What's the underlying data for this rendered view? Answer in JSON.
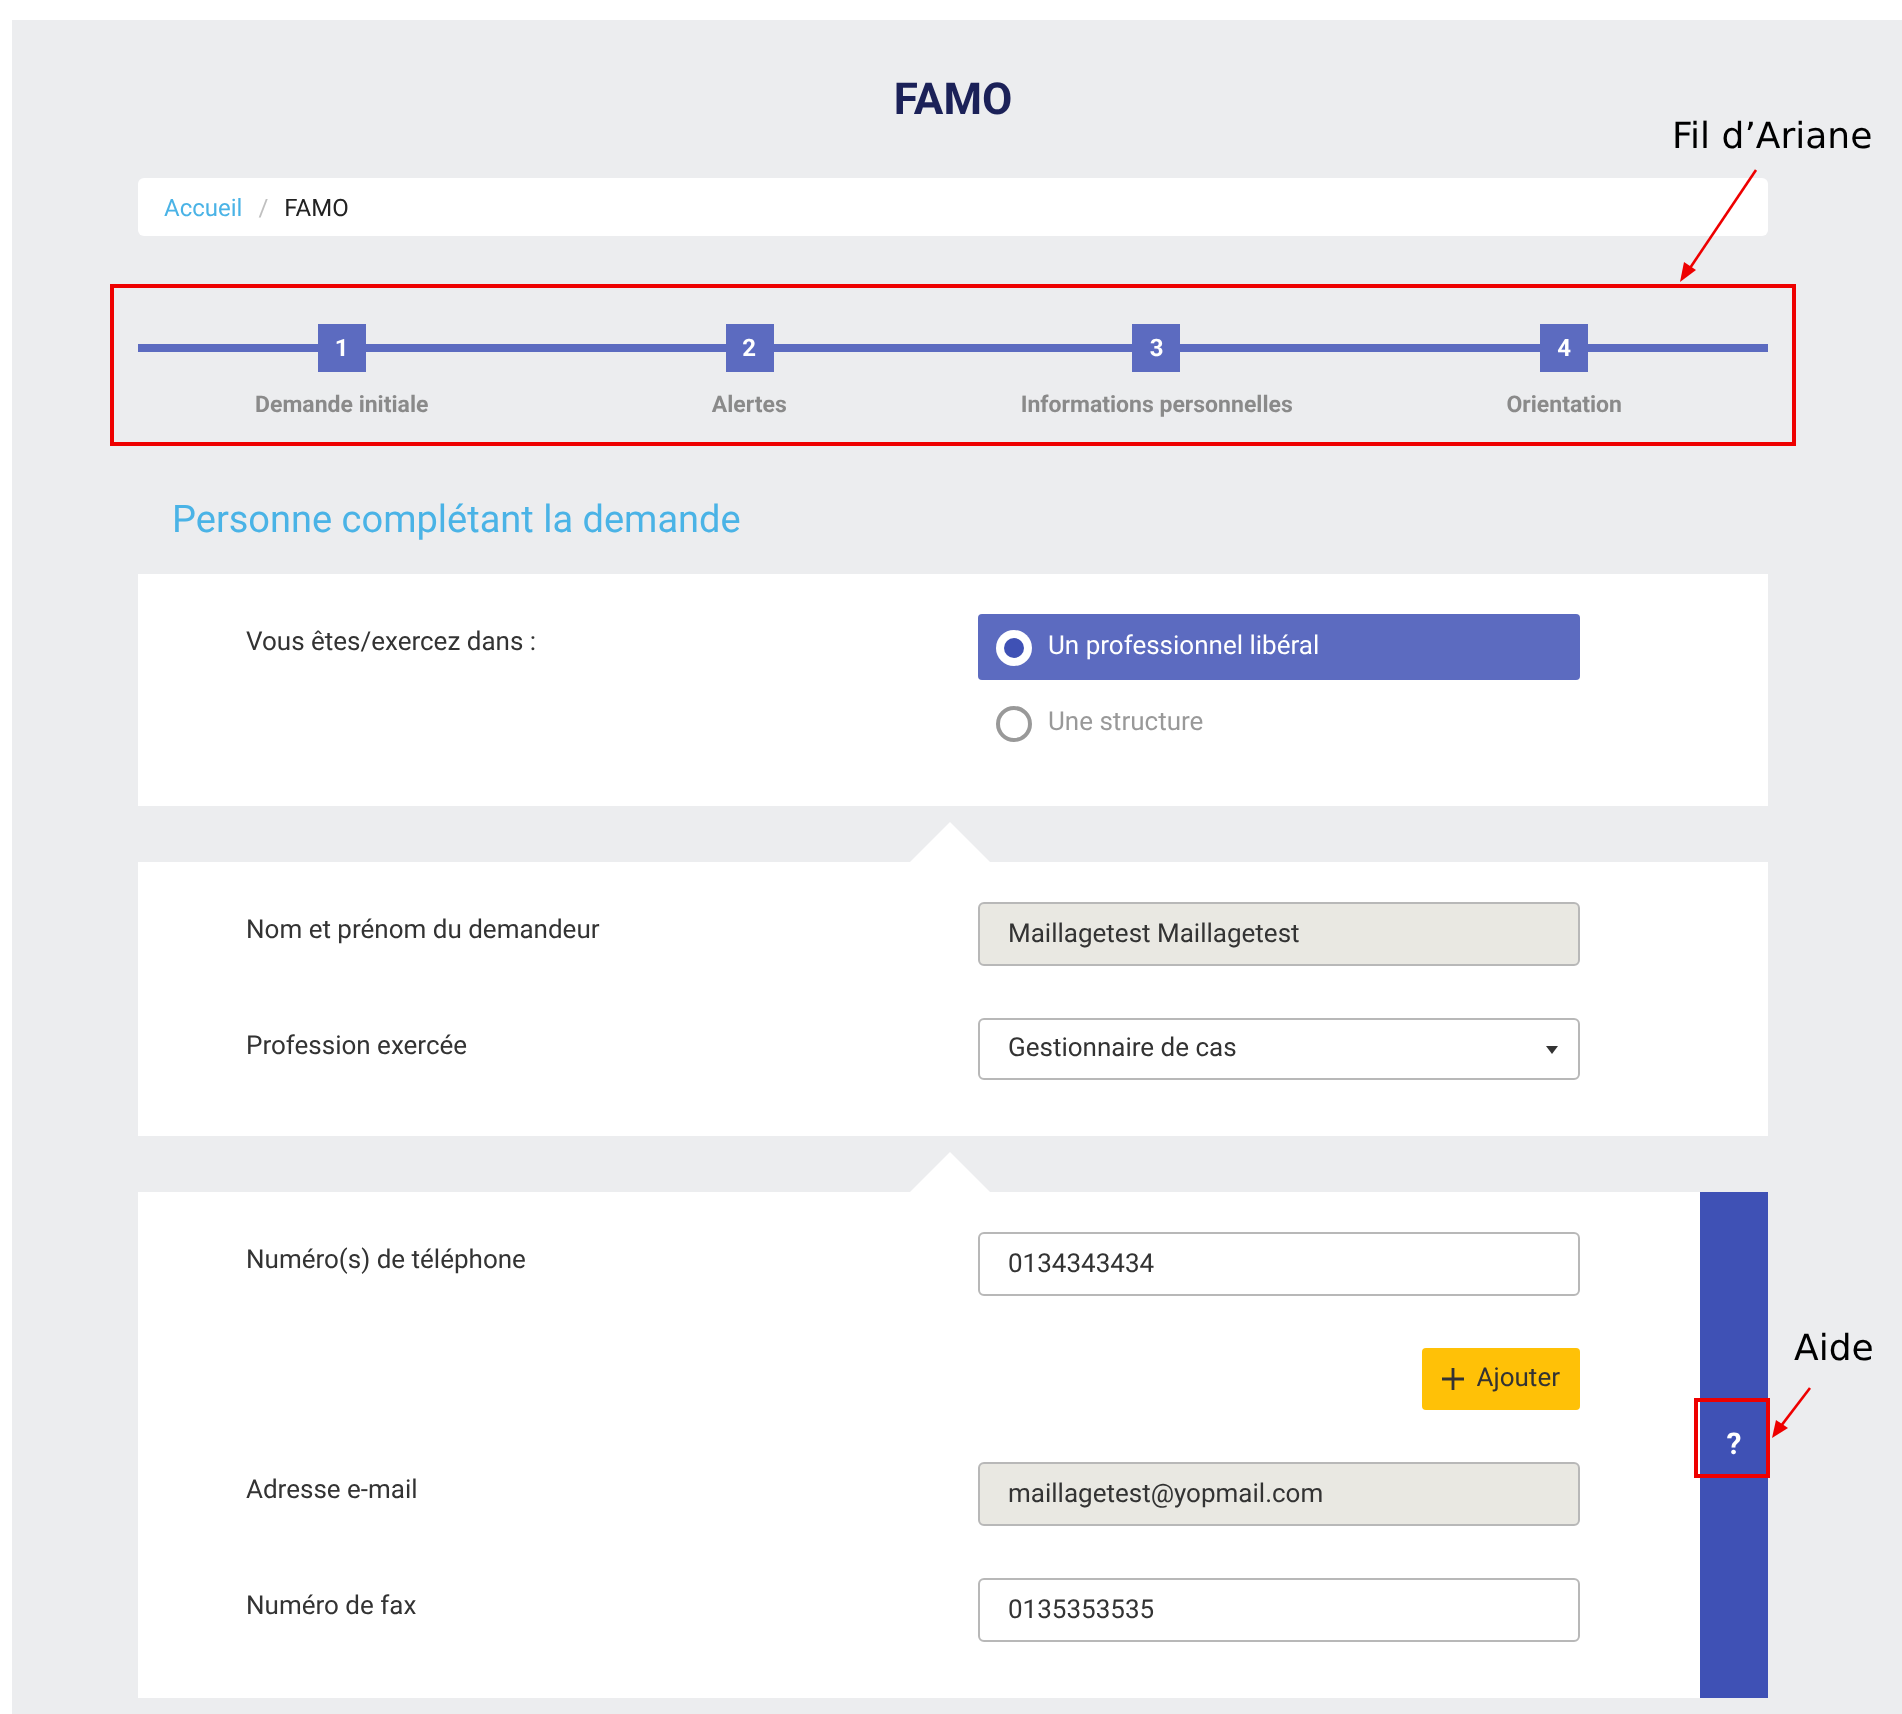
{
  "title": "FAMO",
  "breadcrumb_separator": "/",
  "breadcrumb": [
    {
      "label": "Accueil",
      "link": true
    },
    {
      "label": "FAMO",
      "link": false
    }
  ],
  "steps": [
    {
      "number": "1",
      "label": "Demande initiale"
    },
    {
      "number": "2",
      "label": "Alertes"
    },
    {
      "number": "3",
      "label": "Informations personnelles"
    },
    {
      "number": "4",
      "label": "Orientation"
    }
  ],
  "section_title": "Personne complétant la demande",
  "cards": [
    {
      "rows": [
        {
          "kind": "radio",
          "label": "Vous êtes/exercez dans :",
          "options": [
            {
              "label": "Un professionnel libéral",
              "selected": true
            },
            {
              "label": "Une structure",
              "selected": false
            }
          ]
        }
      ]
    },
    {
      "rows": [
        {
          "kind": "text",
          "label": "Nom et prénom du demandeur",
          "value": "Maillagetest Maillagetest",
          "readonly": true
        },
        {
          "kind": "select",
          "label": "Profession exercée",
          "value": "Gestionnaire de cas"
        }
      ]
    },
    {
      "rows": [
        {
          "kind": "text",
          "label": "Numéro(s) de téléphone",
          "value": "0134343434",
          "readonly": false
        },
        {
          "kind": "button",
          "label": "Ajouter"
        },
        {
          "kind": "text",
          "label": "Adresse e-mail",
          "value": "maillagetest@yopmail.com",
          "readonly": true
        },
        {
          "kind": "text",
          "label": "Numéro de fax",
          "value": "0135353535",
          "readonly": false
        }
      ],
      "help": "?"
    }
  ],
  "annotations": [
    {
      "label": "Fil d’Ariane"
    },
    {
      "label": "Aide"
    }
  ]
}
